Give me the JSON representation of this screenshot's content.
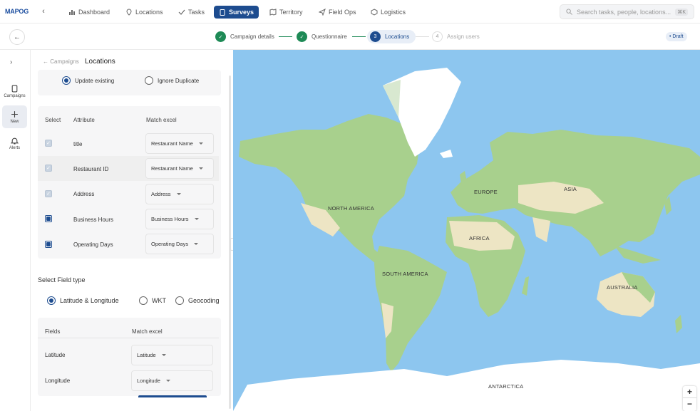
{
  "app": {
    "logo": "MAPOG"
  },
  "nav": [
    {
      "label": "Dashboard",
      "icon": "chart-icon"
    },
    {
      "label": "Locations",
      "icon": "pin-icon"
    },
    {
      "label": "Tasks",
      "icon": "check-icon"
    },
    {
      "label": "Surveys",
      "icon": "clipboard-icon",
      "active": true
    },
    {
      "label": "Territory",
      "icon": "map-icon"
    },
    {
      "label": "Field Ops",
      "icon": "send-icon"
    },
    {
      "label": "Logistics",
      "icon": "box-icon"
    }
  ],
  "search": {
    "placeholder": "Search tasks, people, locations...",
    "shortcut": "⌘K"
  },
  "steps": [
    {
      "label": "Campaign details",
      "state": "done"
    },
    {
      "label": "Questionnaire",
      "state": "done"
    },
    {
      "num": "3",
      "label": "Locations",
      "state": "current"
    },
    {
      "num": "4",
      "label": "Assign users",
      "state": "todo"
    }
  ],
  "status": "• Draft",
  "rail": [
    {
      "label": "Campaigns",
      "icon": "clipboard-icon"
    },
    {
      "label": "New",
      "icon": "plus-icon",
      "active": true
    },
    {
      "label": "Alerts",
      "icon": "bell-icon"
    }
  ],
  "panel": {
    "breadcrumb": "← Campaigns",
    "title": "Locations",
    "duplicate_options": [
      {
        "label": "Update existing",
        "selected": true
      },
      {
        "label": "Ignore Duplicate",
        "selected": false
      }
    ],
    "table_headers": {
      "select": "Select",
      "attribute": "Attribute",
      "match": "Match excel"
    },
    "rows": [
      {
        "attribute": "title",
        "match": "Restaurant Name",
        "check": "disabled"
      },
      {
        "attribute": "Restaurant ID",
        "match": "Restaurant Name",
        "check": "disabled"
      },
      {
        "attribute": "Address",
        "match": "Address",
        "check": "disabled"
      },
      {
        "attribute": "Business Hours",
        "match": "Business Hours",
        "check": "checked"
      },
      {
        "attribute": "Operating Days",
        "match": "Operating Days",
        "check": "checked"
      }
    ],
    "field_type_label": "Select Field type",
    "field_types": [
      {
        "label": "Latitude & Longitude",
        "selected": true
      },
      {
        "label": "WKT",
        "selected": false
      },
      {
        "label": "Geocoding",
        "selected": false
      }
    ],
    "fields_headers": {
      "fields": "Fields",
      "match": "Match excel"
    },
    "fields": [
      {
        "label": "Latitude",
        "match": "Latitude"
      },
      {
        "label": "Longitude",
        "match": "Longitude"
      }
    ]
  },
  "map": {
    "labels": [
      "NORTH AMERICA",
      "SOUTH AMERICA",
      "EUROPE",
      "AFRICA",
      "ASIA",
      "AUSTRALIA",
      "ANTARCTICA"
    ],
    "zoom_in": "+",
    "zoom_out": "−",
    "colors": {
      "ocean": "#8dc6ef",
      "land": "#a8d08d",
      "desert": "#ede5c4",
      "ice": "#ffffff"
    }
  }
}
